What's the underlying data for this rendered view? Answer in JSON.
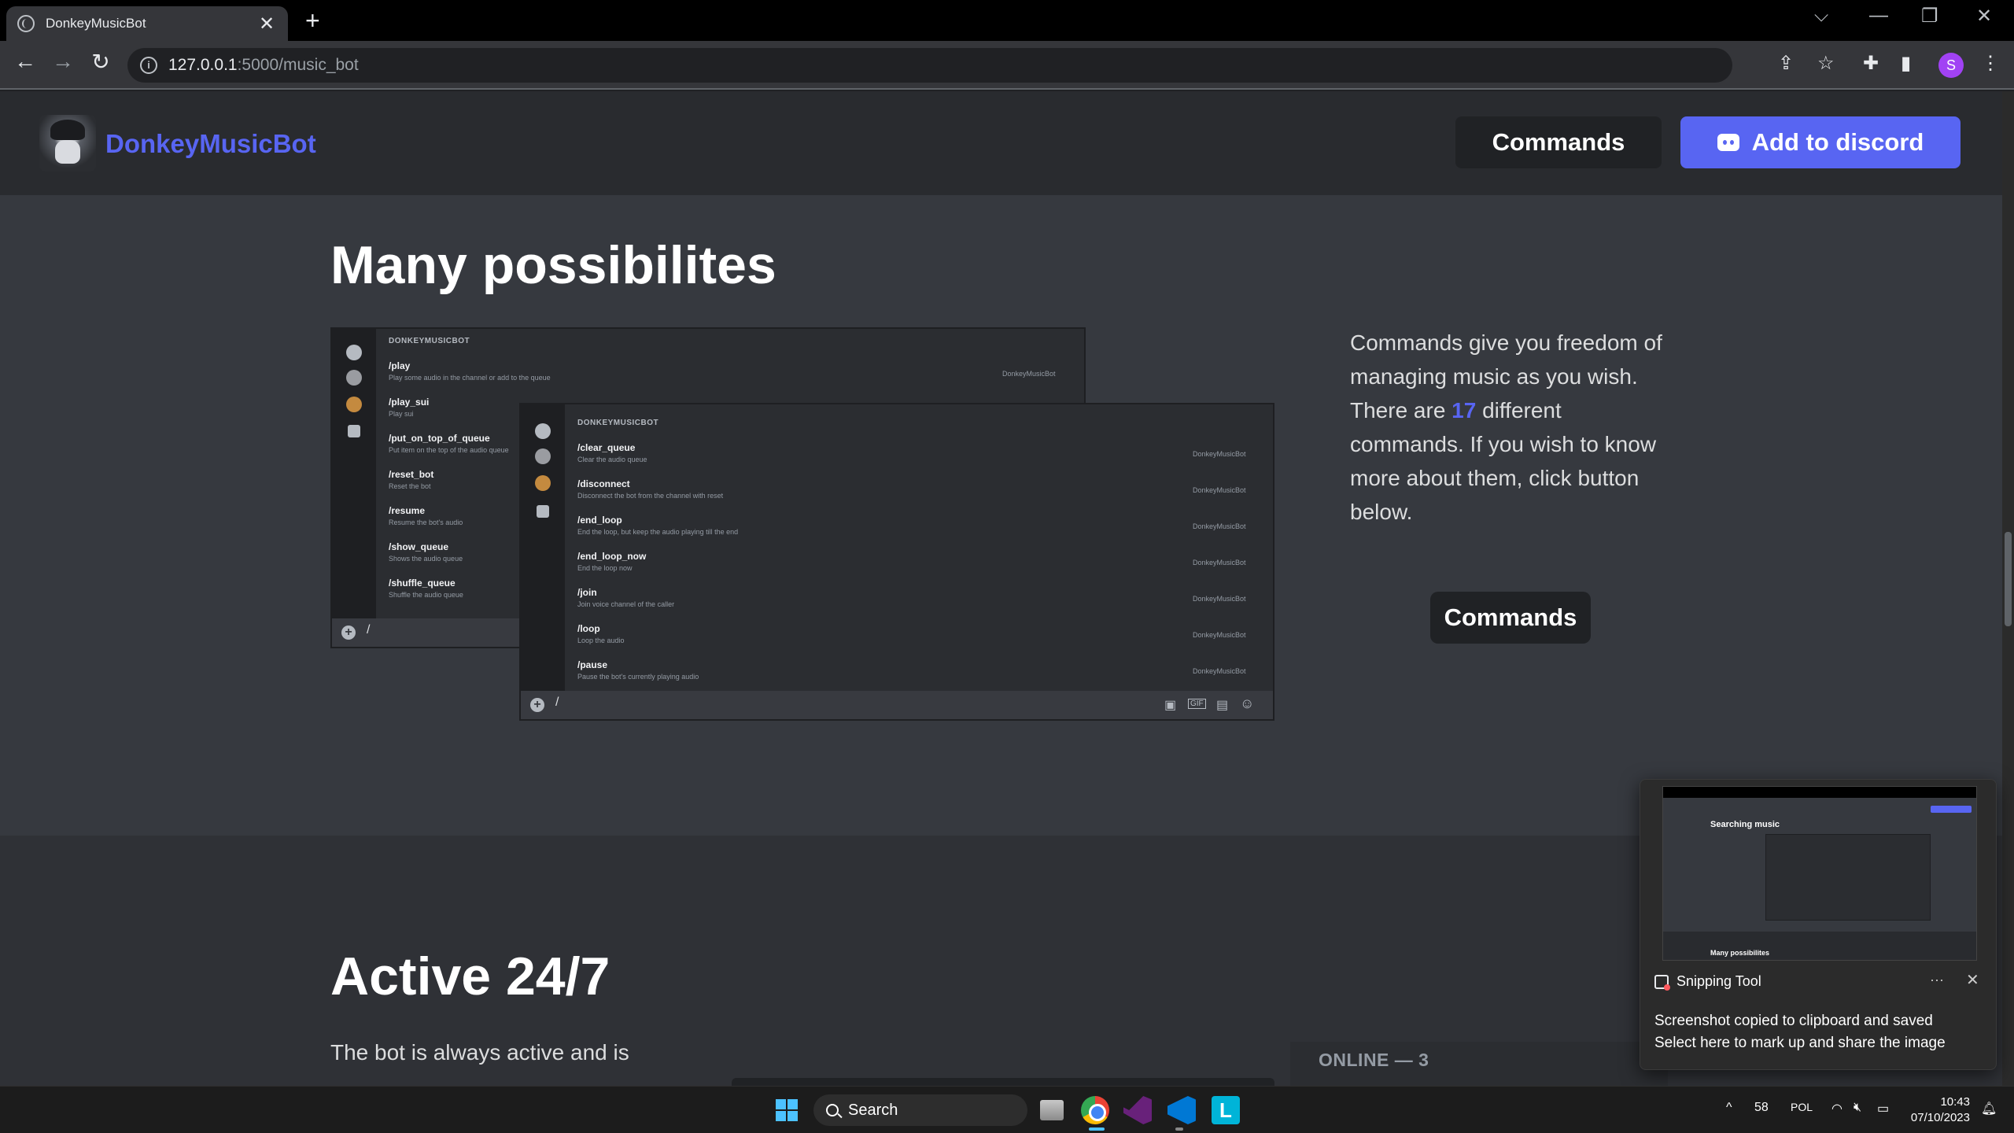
{
  "browser": {
    "tab_title": "DonkeyMusicBot",
    "tab_close": "✕",
    "new_tab": "+",
    "url_host": "127.0.0.1",
    "url_path": ":5000/music_bot",
    "profile_initial": "S",
    "window_controls": [
      "⌵",
      "—",
      "❐",
      "✕"
    ],
    "toolbar_icons": [
      "share-icon",
      "star-icon",
      "extensions-icon",
      "side-panel-icon",
      "menu-icon"
    ]
  },
  "header": {
    "brand": "DonkeyMusicBot",
    "commands_label": "Commands",
    "add_label": "Add to discord",
    "accent": "#5865f2"
  },
  "section1": {
    "title": "Many possibilites",
    "desc_before": "Commands give you freedom of managing music as you wish. There are ",
    "count": "17",
    "desc_after": " different commands. If you wish to know more about them, click button below.",
    "commands_label": "Commands",
    "panel_left": {
      "bot": "DONKEYMUSICBOT",
      "source": "DonkeyMusicBot",
      "commands": [
        {
          "name": "/play",
          "desc": "Play some audio in the channel or add to the queue"
        },
        {
          "name": "/play_sui",
          "desc": "Play sui"
        },
        {
          "name": "/put_on_top_of_queue",
          "desc": "Put item on the top of the audio queue"
        },
        {
          "name": "/reset_bot",
          "desc": "Reset the bot"
        },
        {
          "name": "/resume",
          "desc": "Resume the bot's audio"
        },
        {
          "name": "/show_queue",
          "desc": "Shows the audio queue"
        },
        {
          "name": "/shuffle_queue",
          "desc": "Shuffle the audio queue"
        }
      ],
      "input": "/"
    },
    "panel_right": {
      "bot": "DONKEYMUSICBOT",
      "source": "DonkeyMusicBot",
      "commands": [
        {
          "name": "/clear_queue",
          "desc": "Clear the audio queue"
        },
        {
          "name": "/disconnect",
          "desc": "Disconnect the bot from the channel with reset"
        },
        {
          "name": "/end_loop",
          "desc": "End the loop, but keep the audio playing till the end"
        },
        {
          "name": "/end_loop_now",
          "desc": "End the loop now"
        },
        {
          "name": "/join",
          "desc": "Join voice channel of the caller"
        },
        {
          "name": "/loop",
          "desc": "Loop the audio"
        },
        {
          "name": "/pause",
          "desc": "Pause the bot's currently playing audio"
        }
      ],
      "input": "/"
    }
  },
  "section2": {
    "title": "Active 24/7",
    "text": "The bot is always active and is",
    "online": "ONLINE — 3"
  },
  "toast": {
    "app": "Snipping Tool",
    "more": "···",
    "close": "✕",
    "line1": "Screenshot copied to clipboard and saved",
    "line2": "Select here to mark up and share the image",
    "thumb_title": "Searching music",
    "thumb_footer": "Many possibilites"
  },
  "taskbar": {
    "search": "Search",
    "tray_up": "^",
    "temp": "58",
    "lang": "POL",
    "time": "10:43",
    "date": "07/10/2023"
  }
}
